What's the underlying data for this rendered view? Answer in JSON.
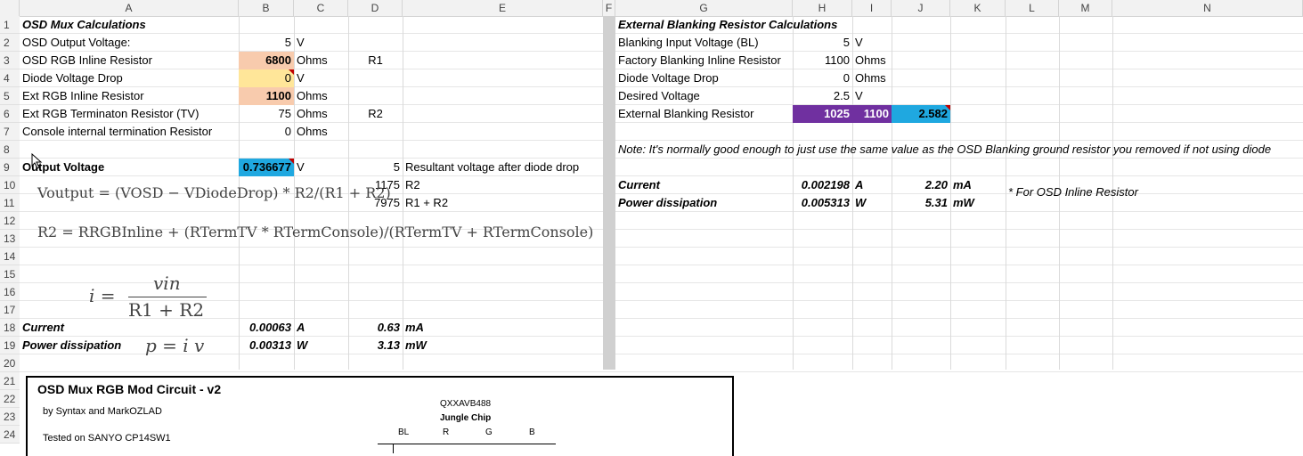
{
  "columns": [
    "A",
    "B",
    "C",
    "D",
    "E",
    "F",
    "G",
    "H",
    "I",
    "J",
    "K",
    "L",
    "M",
    "N"
  ],
  "rows": [
    "1",
    "2",
    "3",
    "4",
    "5",
    "6",
    "7",
    "8",
    "9",
    "10",
    "11",
    "12",
    "13",
    "14",
    "15",
    "16",
    "17",
    "18",
    "19",
    "20",
    "21",
    "22",
    "23",
    "24"
  ],
  "left": {
    "title": "OSD Mux Calculations",
    "rows": [
      {
        "label": "OSD Output Voltage:",
        "value": "5",
        "unit": "V",
        "tag": ""
      },
      {
        "label": "OSD RGB Inline Resistor",
        "value": "6800",
        "unit": "Ohms",
        "tag": "R1"
      },
      {
        "label": "Diode Voltage Drop",
        "value": "0",
        "unit": "V",
        "tag": ""
      },
      {
        "label": "Ext RGB Inline Resistor",
        "value": "1100",
        "unit": "Ohms",
        "tag": ""
      },
      {
        "label": "Ext RGB Terminaton Resistor (TV)",
        "value": "75",
        "unit": "Ohms",
        "tag": "R2"
      },
      {
        "label": "Console internal termination Resistor",
        "value": "0",
        "unit": "Ohms",
        "tag": ""
      }
    ],
    "output": {
      "label": "Output Voltage",
      "value": "0.736677",
      "unit": "V",
      "d": "5",
      "e": "Resultant voltage after diode drop"
    },
    "r2row": {
      "d": "1175",
      "e": "R2"
    },
    "sumrow": {
      "d": "7975",
      "e": "R1 + R2"
    },
    "current": {
      "label": "Current",
      "b": "0.00063",
      "c": "A",
      "d": "0.63",
      "e": "mA"
    },
    "power": {
      "label": "Power dissipation",
      "b": "0.00313",
      "c": "W",
      "d": "3.13",
      "e": "mW"
    },
    "formula1": "Voutput = (VOSD − VDiodeDrop) * R2/(R1 + R2)",
    "formula2": "R2 = RRGBInline + (RTermTV * RTermConsole)/(RTermTV + RTermConsole)",
    "formula3_i": "i =",
    "formula3_num": "vin",
    "formula3_den": "R1 + R2",
    "formula4": "p = i v"
  },
  "right": {
    "title": "External Blanking Resistor Calculations",
    "rows": [
      {
        "label": "Blanking Input Voltage (BL)",
        "value": "5",
        "unit": "V"
      },
      {
        "label": "Factory Blanking Inline Resistor",
        "value": "1100",
        "unit": "Ohms"
      },
      {
        "label": "Diode Voltage Drop",
        "value": "0",
        "unit": "Ohms"
      },
      {
        "label": "Desired Voltage",
        "value": "2.5",
        "unit": "V"
      }
    ],
    "ext": {
      "label": "External Blanking Resistor",
      "h": "1025",
      "i": "1100",
      "j": "2.582"
    },
    "note": "Note: It's normally good enough to just use the same value as the OSD Blanking ground resistor you removed if not using diode",
    "current": {
      "label": "Current",
      "h": "0.002198",
      "i": "A",
      "j": "2.20",
      "k": "mA"
    },
    "power": {
      "label": "Power dissipation",
      "h": "0.005313",
      "i": "W",
      "j": "5.31",
      "k": "mW"
    },
    "footnote": "* For OSD Inline Resistor"
  },
  "circuit": {
    "title": "OSD Mux RGB Mod Circuit - v2",
    "byline": "by Syntax and MarkOZLAD",
    "tested": "Tested on SANYO CP14SW1",
    "chip_id": "QXXAVB488",
    "chip_name": "Jungle Chip",
    "pins": [
      "BL",
      "R",
      "G",
      "B"
    ]
  },
  "colors": {
    "orange": "#f8cbad",
    "yellow": "#ffe699",
    "blue": "#1fa8e0",
    "purple": "#7030a0"
  }
}
